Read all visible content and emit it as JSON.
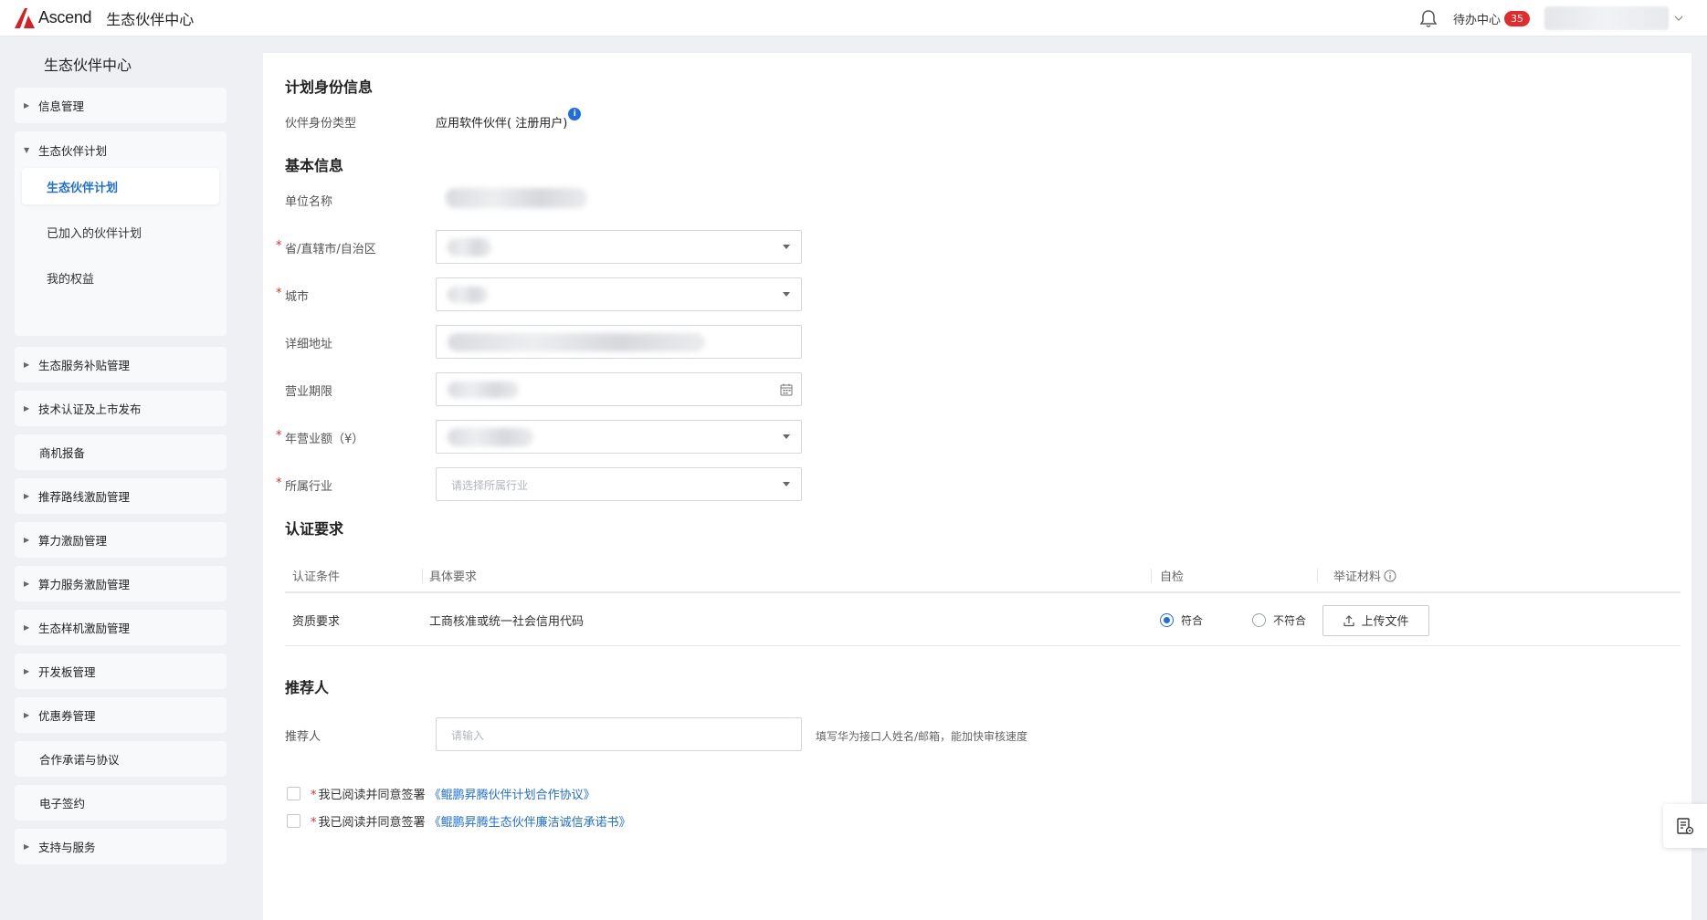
{
  "header": {
    "logo_text": "Ascend",
    "app_title": "生态伙伴中心",
    "todo_label": "待办中心",
    "todo_count": "35"
  },
  "sidebar": {
    "title": "生态伙伴中心",
    "items": [
      {
        "label": "信息管理",
        "caret": true
      },
      {
        "label": "生态伙伴计划",
        "caret": true,
        "expanded": true,
        "children": [
          {
            "label": "生态伙伴计划",
            "active": true
          },
          {
            "label": "已加入的伙伴计划"
          },
          {
            "label": "我的权益"
          }
        ]
      },
      {
        "label": "生态服务补贴管理",
        "caret": true
      },
      {
        "label": "技术认证及上市发布",
        "caret": true
      },
      {
        "label": "商机报备",
        "caret": false
      },
      {
        "label": "推荐路线激励管理",
        "caret": true
      },
      {
        "label": "算力激励管理",
        "caret": true
      },
      {
        "label": "算力服务激励管理",
        "caret": true
      },
      {
        "label": "生态样机激励管理",
        "caret": true
      },
      {
        "label": "开发板管理",
        "caret": true
      },
      {
        "label": "优惠券管理",
        "caret": true
      },
      {
        "label": "合作承诺与协议",
        "caret": false
      },
      {
        "label": "电子签约",
        "caret": false
      },
      {
        "label": "支持与服务",
        "caret": true
      }
    ]
  },
  "identity": {
    "section_title": "计划身份信息",
    "type_label": "伙伴身份类型",
    "type_value": "应用软件伙伴( 注册用户)",
    "info_icon_text": "i"
  },
  "basic": {
    "section_title": "基本信息",
    "company_label": "单位名称",
    "province_label": "省/直辖市/自治区",
    "city_label": "城市",
    "address_label": "详细地址",
    "term_label": "营业期限",
    "revenue_label": "年营业额（¥）",
    "industry_label": "所属行业",
    "industry_placeholder": "请选择所属行业",
    "required_mark": "*"
  },
  "cert": {
    "section_title": "认证要求",
    "headers": [
      "认证条件",
      "具体要求",
      "自检",
      "举证材料"
    ],
    "row": {
      "condition": "资质要求",
      "requirement": "工商核准或统一社会信用代码",
      "option_yes": "符合",
      "option_no": "不符合",
      "selected": "符合",
      "upload_label": "上传文件"
    }
  },
  "referrer": {
    "section_title": "推荐人",
    "label": "推荐人",
    "placeholder": "请输入",
    "hint": "填写华为接口人姓名/邮箱，能加快审核速度"
  },
  "agreements": [
    {
      "prefix": "我已阅读并同意签署",
      "link": "《鲲鹏昇腾伙伴计划合作协议》"
    },
    {
      "prefix": "我已阅读并同意签署",
      "link": "《鲲鹏昇腾生态伙伴廉洁诚信承诺书》"
    }
  ],
  "colors": {
    "accent": "#1e6fd9",
    "badge": "#e32b2b",
    "required": "#e02e2e"
  }
}
